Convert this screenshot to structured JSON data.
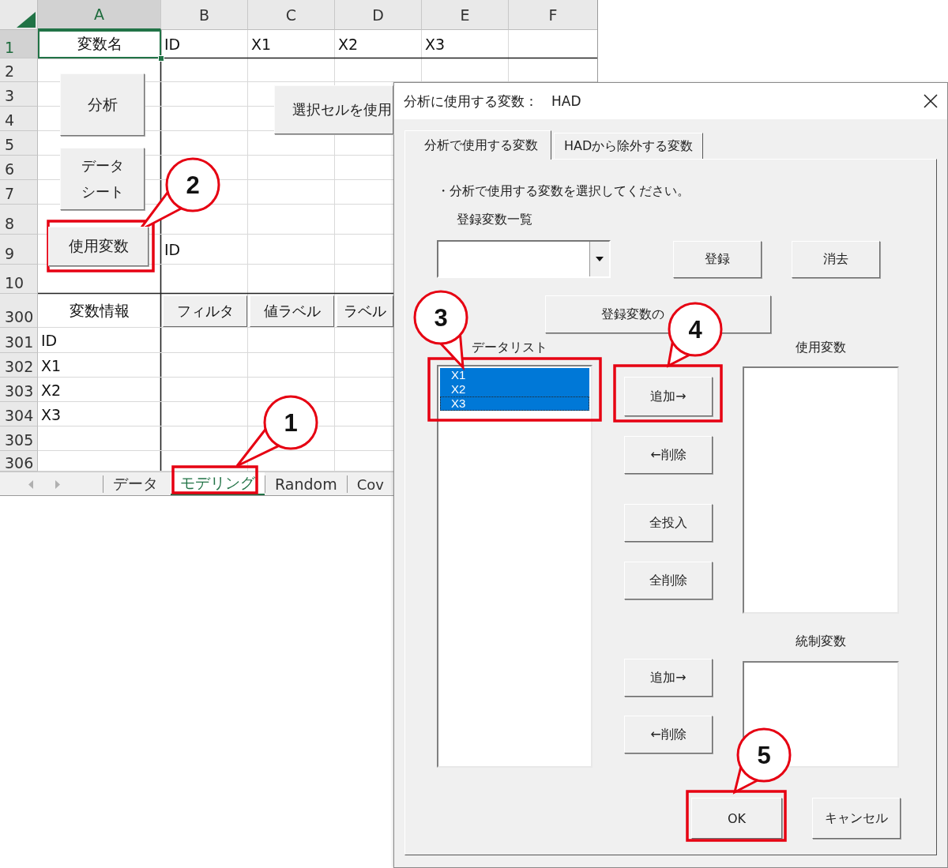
{
  "sheet": {
    "columns": [
      "A",
      "B",
      "C",
      "D",
      "E",
      "F"
    ],
    "rows": [
      {
        "number": "1",
        "cells": [
          {
            "text": "変数名",
            "kind": "heading",
            "selected": true
          },
          {
            "text": "ID",
            "kind": "value",
            "selected": false
          },
          {
            "text": "X1",
            "kind": "value",
            "selected": false
          },
          {
            "text": "X2",
            "kind": "value",
            "selected": false
          },
          {
            "text": "X3",
            "kind": "value",
            "selected": false
          }
        ]
      },
      {
        "number": "2"
      },
      {
        "number": "3"
      },
      {
        "number": "4"
      },
      {
        "number": "5"
      },
      {
        "number": "6"
      },
      {
        "number": "7"
      },
      {
        "number": "8"
      },
      {
        "number": "9",
        "cells": [
          null,
          {
            "text": "ID",
            "kind": "value",
            "selected": false
          }
        ]
      },
      {
        "number": "10"
      },
      {
        "number": "300",
        "cells": [
          {
            "text": "変数情報",
            "kind": "heading",
            "selected": false
          }
        ],
        "header_buttons": [
          "フィルタ",
          "値ラベル",
          "ラベル"
        ]
      },
      {
        "number": "301",
        "cells": [
          {
            "text": "ID",
            "kind": "value",
            "selected": false
          }
        ]
      },
      {
        "number": "302",
        "cells": [
          {
            "text": "X1",
            "kind": "value",
            "selected": false
          }
        ]
      },
      {
        "number": "303",
        "cells": [
          {
            "text": "X2",
            "kind": "value",
            "selected": false
          }
        ]
      },
      {
        "number": "304",
        "cells": [
          {
            "text": "X3",
            "kind": "value",
            "selected": false
          }
        ]
      },
      {
        "number": "305"
      },
      {
        "number": "306"
      }
    ],
    "buttons": [
      "分析",
      "データシート",
      "使用変数",
      "選択セルを使用"
    ],
    "tabs": [
      {
        "label": "データ",
        "selected": false
      },
      {
        "label": "モデリング",
        "selected": true
      },
      {
        "label": "Random",
        "selected": false
      },
      {
        "label": "Cov",
        "selected": false
      }
    ]
  },
  "dialog": {
    "title": "分析に使用する変数：　HAD",
    "tabs": [
      {
        "label": "分析で使用する変数",
        "selected": true
      },
      {
        "label": "HADから除外する変数",
        "selected": false
      }
    ],
    "instruction": "・分析で使用する変数を選択してください。",
    "registered_label": "登録変数一覧",
    "register_button": "登録",
    "erase_button": "消去",
    "registered_table_button": "登録変数の",
    "data_list": {
      "label": "データリスト",
      "items": [
        {
          "text": "X1",
          "selected": true,
          "focused": false
        },
        {
          "text": "X2",
          "selected": true,
          "focused": false
        },
        {
          "text": "X3",
          "selected": true,
          "focused": true
        }
      ]
    },
    "used_vars": {
      "label": "使用変数",
      "add_button": "追加→",
      "remove_button": "←削除",
      "add_all_button": "全投入",
      "remove_all_button": "全削除"
    },
    "control_vars": {
      "label": "統制変数",
      "add_button": "追加→",
      "remove_button": "←削除"
    },
    "ok_button": "OK",
    "cancel_button": "キャンセル"
  },
  "callouts": [
    {
      "number": "1"
    },
    {
      "number": "2"
    },
    {
      "number": "3"
    },
    {
      "number": "4"
    },
    {
      "number": "5"
    }
  ]
}
